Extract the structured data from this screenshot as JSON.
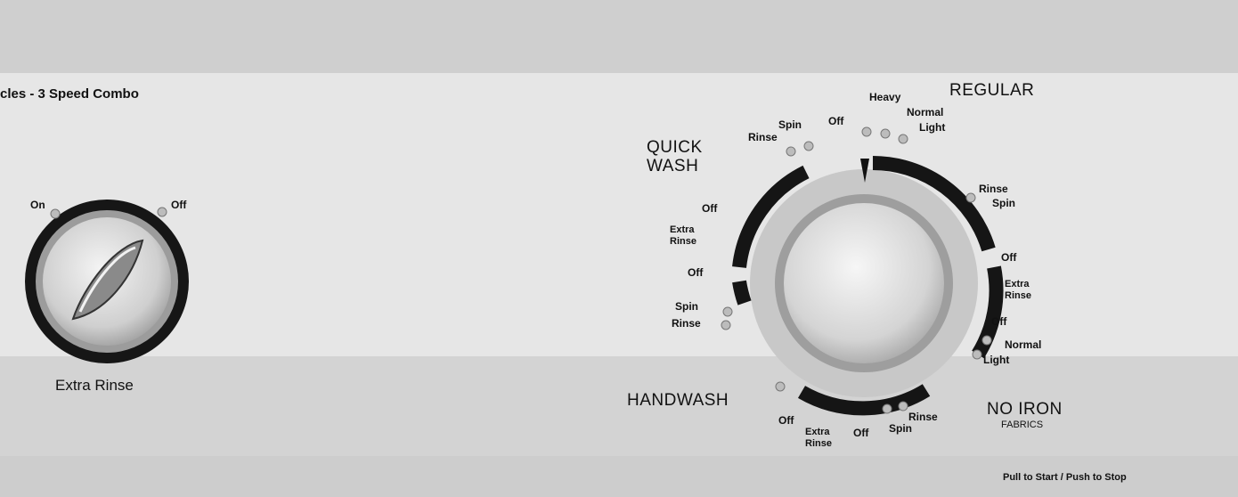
{
  "panel": {
    "header_text": "cles - 3 Speed Combo",
    "footer_text": "Pull to Start / Push to Stop"
  },
  "extra_rinse_knob": {
    "label": "Extra Rinse",
    "on_label": "On",
    "off_label": "Off"
  },
  "cycle_dial": {
    "sections": {
      "regular": "REGULAR",
      "quick_wash": "QUICK\nWASH",
      "handwash": "HANDWASH",
      "no_iron": "NO IRON",
      "no_iron_sub": "FABRICS"
    },
    "regular_labels": {
      "heavy": "Heavy",
      "normal": "Normal",
      "light": "Light",
      "off_top": "Off",
      "rinse": "Rinse",
      "spin": "Spin",
      "off_right": "Off",
      "extra_rinse": "Extra\nRinse"
    },
    "no_iron_labels": {
      "off": "Off",
      "normal": "Normal",
      "light": "Light",
      "rinse": "Rinse",
      "spin": "Spin"
    },
    "handwash_labels": {
      "off": "Off",
      "extra_rinse": "Extra\nRinse",
      "off2": "Off"
    },
    "quick_wash_labels": {
      "spin": "Spin",
      "rinse": "Rinse",
      "off": "Off",
      "extra_rinse": "Extra\nRinse",
      "off2": "Off",
      "spin2": "Spin",
      "rinse2": "Rinse"
    }
  }
}
